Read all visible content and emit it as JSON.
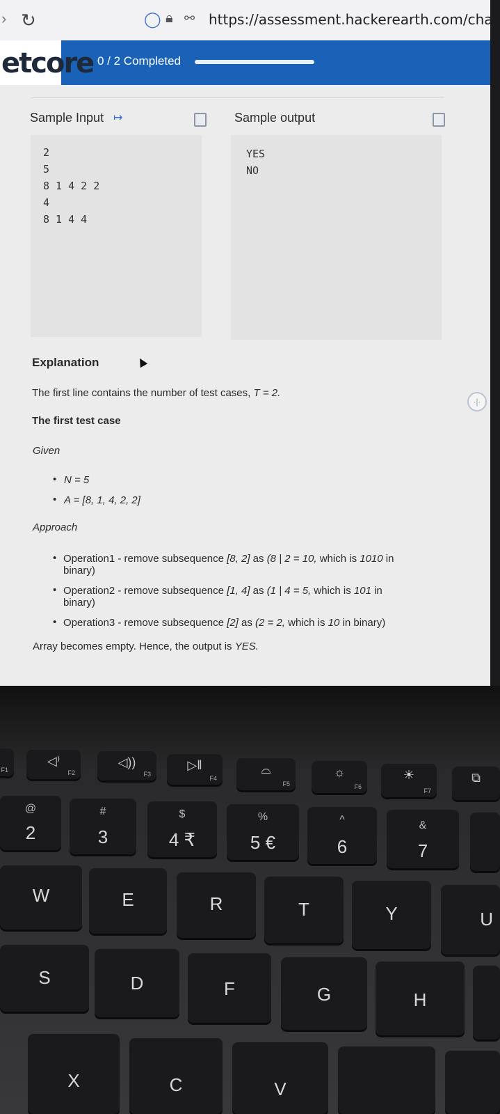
{
  "browser": {
    "url": "https://assessment.hackerearth.com/challenge"
  },
  "header": {
    "logo_text": "etcore",
    "progress_text": "0 / 2 Completed"
  },
  "sample_input": {
    "title": "Sample Input",
    "lines": [
      "2",
      "5",
      "8 1 4 2 2",
      "4",
      "8 1 4 4"
    ]
  },
  "sample_output": {
    "title": "Sample output",
    "lines": [
      "YES",
      "NO"
    ]
  },
  "explanation": {
    "heading": "Explanation",
    "intro_prefix": "The first line contains the number of test cases, ",
    "intro_value": "T = 2.",
    "first_case_heading": "The first test case",
    "given_label": "Given",
    "given_items": [
      "N = 5",
      "A = [8, 1, 4, 2, 2]"
    ],
    "approach_label": "Approach",
    "op1_line1_a": "Operation1 - remove subsequence ",
    "op1_line1_b": "[8, 2]",
    "op1_line1_c": " as ",
    "op1_line1_d": "(8 | 2 = 10,",
    "op1_line1_e": " which is ",
    "op1_line1_f": "1010",
    "op1_line1_g": " in",
    "op1_line2": "binary)",
    "op2_line1_a": "Operation2 - remove subsequence ",
    "op2_line1_b": "[1, 4]",
    "op2_line1_c": " as ",
    "op2_line1_d": "(1 | 4 = 5,",
    "op2_line1_e": " which is ",
    "op2_line1_f": "101",
    "op2_line1_g": " in",
    "op2_line2": "binary)",
    "op3_a": "Operation3 - remove subsequence ",
    "op3_b": "[2]",
    "op3_c": " as ",
    "op3_d": "(2 = 2,",
    "op3_e": " which is ",
    "op3_f": "10",
    "op3_g": " in binary)",
    "conclusion_a": "Array becomes empty. Hence, the output is ",
    "conclusion_b": "YES."
  },
  "keyboard": {
    "fn_row": [
      {
        "label": "F1"
      },
      {
        "label": "F2"
      },
      {
        "label": "F3"
      },
      {
        "label": "F4"
      },
      {
        "label": "F5"
      },
      {
        "label": "F6"
      },
      {
        "label": "F7"
      }
    ],
    "number_row": [
      {
        "top": "@",
        "main": "2"
      },
      {
        "top": "#",
        "main": "3"
      },
      {
        "top": "$",
        "main": "4 ₹"
      },
      {
        "top": "%",
        "main": "5 €"
      },
      {
        "top": "^",
        "main": "6"
      },
      {
        "top": "&",
        "main": "7"
      }
    ],
    "letter_row1": [
      "W",
      "E",
      "R",
      "T",
      "Y",
      "U"
    ],
    "letter_row2": [
      "S",
      "D",
      "F",
      "G",
      "H"
    ],
    "letter_row3": [
      "X",
      "C",
      "V"
    ]
  },
  "icons": {
    "reload": "reload-icon",
    "shield": "shield-icon",
    "lock": "lock-icon",
    "permissions": "permissions-icon",
    "copy": "copy-icon",
    "open_input": "open-external-icon"
  }
}
